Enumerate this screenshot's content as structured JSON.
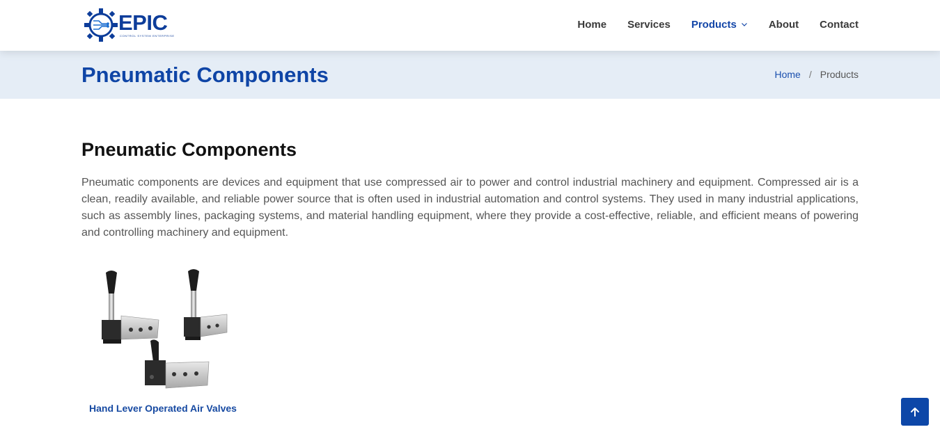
{
  "brand": {
    "name": "EPIC",
    "tagline": "Control System Enterprise",
    "color": "#0d3d9a"
  },
  "nav": {
    "items": [
      {
        "label": "Home"
      },
      {
        "label": "Services"
      },
      {
        "label": "Products",
        "active": true,
        "has_dropdown": true
      },
      {
        "label": "About"
      },
      {
        "label": "Contact"
      }
    ],
    "active_color": "#1346a8"
  },
  "banner": {
    "title": "Pneumatic Components",
    "breadcrumb": {
      "home": "Home",
      "separator": "/",
      "current": "Products"
    }
  },
  "content": {
    "title": "Pneumatic Components",
    "description": "Pneumatic components are devices and equipment that use compressed air to power and control industrial machinery and equipment. Compressed air is a clean, readily available, and reliable power source that is often used in industrial automation and control systems. They used in many industrial applications, such as assembly lines, packaging systems, and material handling equipment, where they provide a cost-effective, reliable, and efficient means of powering and controlling machinery and equipment."
  },
  "products": [
    {
      "label": "Hand Lever Operated Air Valves",
      "image": "hand-lever-valves-image"
    }
  ],
  "back_to_top": {
    "icon": "arrow-up-icon",
    "color": "#0d47a8"
  }
}
